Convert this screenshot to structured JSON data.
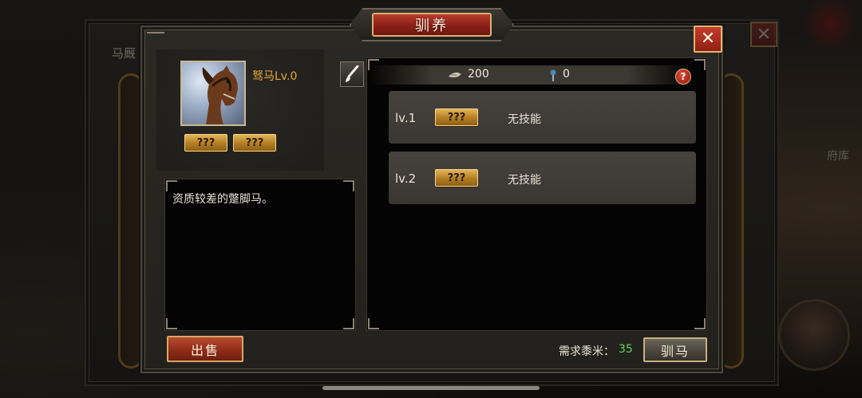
{
  "background": {
    "title": "马厩",
    "right_label": "府库"
  },
  "dialog": {
    "title": "驯养",
    "close_symbol": "✕"
  },
  "horse": {
    "name": "驽马Lv.0",
    "portrait": "horse-portrait",
    "tags": [
      "???",
      "???"
    ],
    "description": "资质较差的蹩脚马。"
  },
  "resources": [
    {
      "icon": "grain-icon",
      "value": "200"
    },
    {
      "icon": "whistle-icon",
      "value": "0"
    }
  ],
  "skills": [
    {
      "level": "lv.1",
      "tag": "???",
      "skill": "无技能"
    },
    {
      "level": "lv.2",
      "tag": "???",
      "skill": "无技能"
    }
  ],
  "actions": {
    "sell_label": "出售",
    "requirement_label": "需求黍米：",
    "requirement_value": "35",
    "train_label": "驯马",
    "help_symbol": "?"
  },
  "colors": {
    "accent_gold": "#e8a93a",
    "requirement_green": "#5ed65a",
    "title_red": "#8a2118"
  }
}
